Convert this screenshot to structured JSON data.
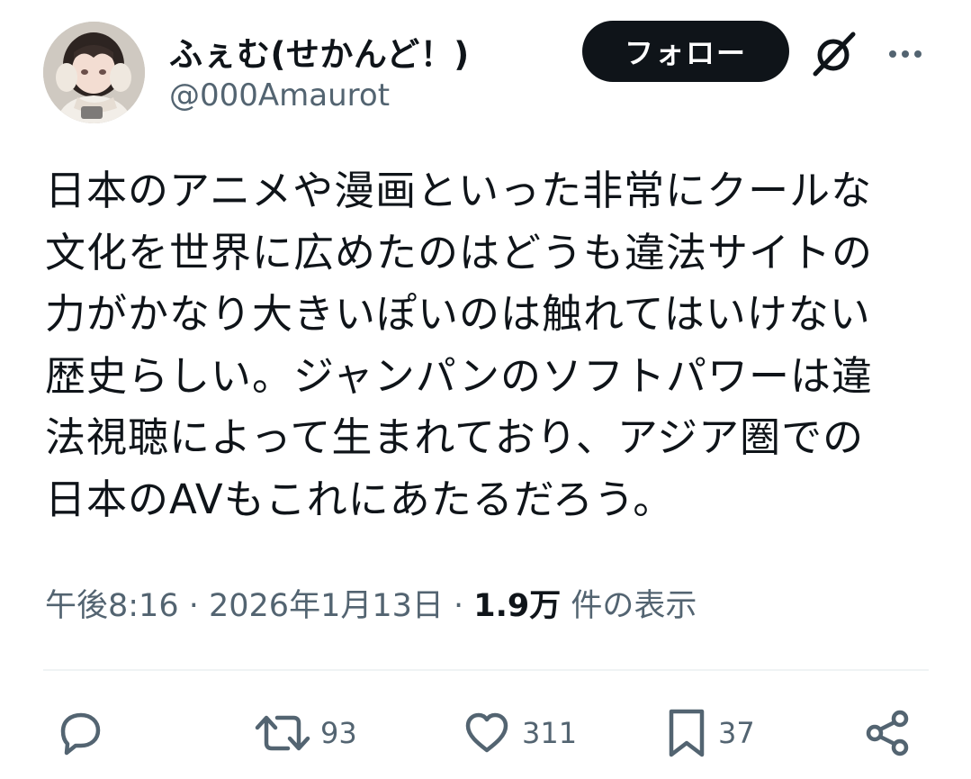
{
  "author": {
    "display_name": "ふぇむ(せかんど！)",
    "handle": "@000Amaurot",
    "avatar": "anime-girl-avatar"
  },
  "header": {
    "follow_label": "フォロー",
    "grok_icon": "grok-icon",
    "more_icon": "more-dots-icon"
  },
  "tweet": {
    "lines": [
      "日本のアニメや漫画といった非常にクールな",
      "文化を世界に広めたのはどうも違法サイトの",
      "力がかなり大きいぽいのは触れてはいけない",
      "歴史らしい。ジャンパンのソフトパワーは違",
      "法視聴によって生まれており、アジア圏での",
      "日本のAVもこれにあたるだろう。"
    ]
  },
  "meta": {
    "time": "午後8:16",
    "separator1": " · ",
    "date": "2026年1月13日",
    "separator2": " · ",
    "views_count": "1.9万",
    "views_label": " 件の表示"
  },
  "actions": {
    "reply_icon": "reply-icon",
    "retweet_icon": "retweet-icon",
    "retweet_count": "93",
    "like_icon": "heart-icon",
    "like_count": "311",
    "bookmark_icon": "bookmark-icon",
    "bookmark_count": "37",
    "share_icon": "share-icon"
  },
  "colors": {
    "text": "#0f1419",
    "secondary": "#536471",
    "follow_bg": "#0f1419",
    "divider": "#eff3f4"
  }
}
